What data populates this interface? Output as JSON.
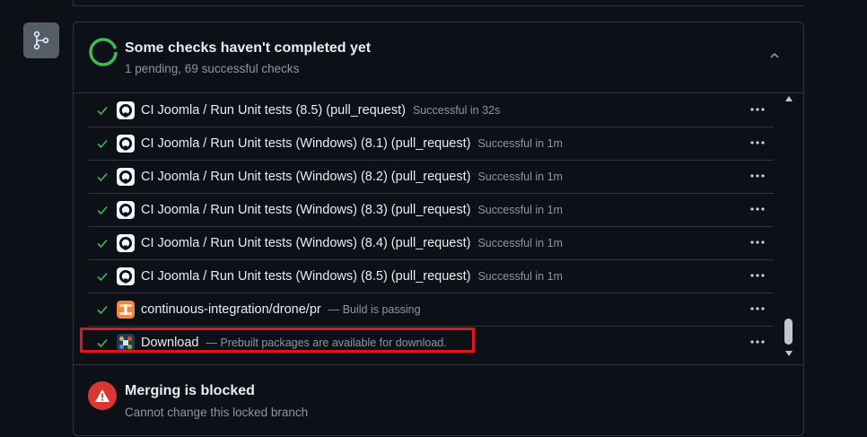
{
  "header": {
    "title": "Some checks haven't completed yet",
    "subtitle": "1 pending, 69 successful checks"
  },
  "checks": [
    {
      "name": "CI Joomla / Run Unit tests (8.5) (pull_request)",
      "desc": "Successful in 32s",
      "icon": "github-icon"
    },
    {
      "name": "CI Joomla / Run Unit tests (Windows) (8.1) (pull_request)",
      "desc": "Successful in 1m",
      "icon": "github-icon"
    },
    {
      "name": "CI Joomla / Run Unit tests (Windows) (8.2) (pull_request)",
      "desc": "Successful in 1m",
      "icon": "github-icon"
    },
    {
      "name": "CI Joomla / Run Unit tests (Windows) (8.3) (pull_request)",
      "desc": "Successful in 1m",
      "icon": "github-icon"
    },
    {
      "name": "CI Joomla / Run Unit tests (Windows) (8.4) (pull_request)",
      "desc": "Successful in 1m",
      "icon": "github-icon"
    },
    {
      "name": "CI Joomla / Run Unit tests (Windows) (8.5) (pull_request)",
      "desc": "Successful in 1m",
      "icon": "github-icon"
    },
    {
      "name": "continuous-integration/drone/pr",
      "desc": "— Build is passing",
      "icon": "drone-icon"
    },
    {
      "name": "Download",
      "desc": "— Prebuilt packages are available for download.",
      "icon": "joomla-icon"
    }
  ],
  "merge": {
    "title": "Merging is blocked",
    "subtitle": "Cannot change this locked branch"
  },
  "colors": {
    "success": "#3fb950",
    "danger": "#da3633",
    "highlight": "#e2141b",
    "muted": "#8d96a0"
  }
}
